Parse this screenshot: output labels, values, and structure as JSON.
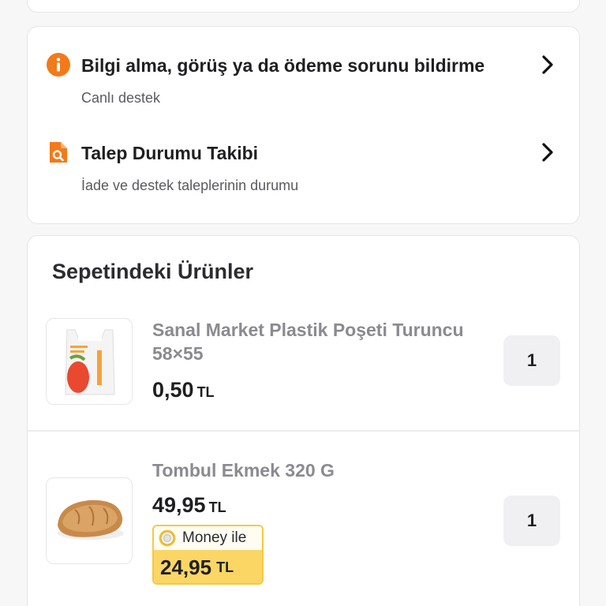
{
  "support": {
    "items": [
      {
        "title": "Bilgi alma, görüş ya da ödeme sorunu bildirme",
        "subtitle": "Canlı destek",
        "icon": "info-icon"
      },
      {
        "title": "Talep Durumu Takibi",
        "subtitle": "İade ve destek taleplerinin durumu",
        "icon": "document-search-icon"
      }
    ]
  },
  "cart": {
    "title": "Sepetindeki Ürünler",
    "items": [
      {
        "name": "Sanal Market Plastik Poşeti Turuncu 58×55",
        "price": "0,50",
        "currency": "TL",
        "quantity": "1",
        "image": "plastic-bag-image"
      },
      {
        "name": "Tombul Ekmek 320 G",
        "price": "49,95",
        "currency": "TL",
        "quantity": "1",
        "image": "bread-image",
        "money": {
          "label": "Money ile",
          "price": "24,95",
          "currency": "TL"
        }
      }
    ]
  },
  "colors": {
    "accent": "#f27a1a",
    "money_yellow": "#fbd665",
    "money_border": "#f6c842"
  }
}
